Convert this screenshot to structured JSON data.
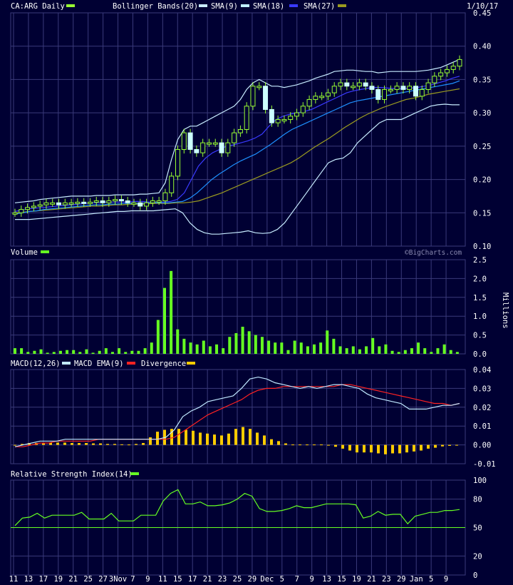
{
  "symbol_label": "CA:ARG Daily",
  "date": "1/10/17",
  "watermark": "©BigCharts.com",
  "colors": {
    "background": "#000033",
    "grid": "#3a3a7a",
    "price": "#99ff33",
    "candle_up": "#000033",
    "candle_hi": "#ccffff",
    "bollinger": "#c8ecff",
    "sma9": "#bfefff",
    "sma18": "#3a3aff",
    "sma27": "#1e90ff",
    "sma_olive": "#9a9a20",
    "volume": "#66ff22",
    "macd": "#c0e8ff",
    "macd_ema": "#ff2222",
    "divergence": "#ffcc00",
    "rsi": "#66ff22",
    "rsi_mid": "#66ff22"
  },
  "legend": {
    "main": [
      {
        "label": "CA:ARG Daily",
        "color": "#99ff33"
      },
      {
        "label": "Bollinger Bands(20)",
        "color": "#c8ecff"
      },
      {
        "label": "SMA(9)",
        "color": "#bfefff"
      },
      {
        "label": "SMA(18)",
        "color": "#3a3aff"
      },
      {
        "label": "SMA(27)",
        "color": "#9a9a20"
      }
    ],
    "volume": "Volume",
    "volume_unit": "Millions",
    "macd": [
      {
        "label": "MACD(12,26)",
        "color": "#c0e8ff"
      },
      {
        "label": "MACD EMA(9)",
        "color": "#ff2222"
      },
      {
        "label": "Divergence",
        "color": "#ffcc00"
      }
    ],
    "rsi": "Relative Strength Index(14)"
  },
  "chart_data": [
    {
      "type": "line",
      "title": "CA:ARG Daily",
      "ylim": [
        0.1,
        0.45
      ],
      "yticks": [
        "0.45",
        "0.40",
        "0.35",
        "0.30",
        "0.25",
        "0.20",
        "0.15",
        "0.10"
      ],
      "xticks": [
        "11",
        "13",
        "17",
        "19",
        "21",
        "25",
        "27",
        "3Nov",
        "7",
        "9",
        "11",
        "15",
        "17",
        "21",
        "23",
        "25",
        "29",
        "Dec",
        "5",
        "7",
        "9",
        "13",
        "15",
        "19",
        "21",
        "23",
        "29",
        "Jan",
        "5",
        "9"
      ],
      "candles_close": [
        0.15,
        0.155,
        0.158,
        0.16,
        0.162,
        0.165,
        0.165,
        0.162,
        0.165,
        0.165,
        0.166,
        0.165,
        0.166,
        0.168,
        0.165,
        0.168,
        0.17,
        0.168,
        0.165,
        0.165,
        0.16,
        0.165,
        0.168,
        0.168,
        0.18,
        0.205,
        0.245,
        0.27,
        0.245,
        0.24,
        0.255,
        0.255,
        0.255,
        0.24,
        0.255,
        0.27,
        0.275,
        0.31,
        0.34,
        0.34,
        0.305,
        0.285,
        0.29,
        0.29,
        0.295,
        0.3,
        0.31,
        0.32,
        0.325,
        0.325,
        0.33,
        0.34,
        0.345,
        0.34,
        0.34,
        0.345,
        0.34,
        0.335,
        0.32,
        0.335,
        0.335,
        0.34,
        0.335,
        0.34,
        0.325,
        0.335,
        0.345,
        0.355,
        0.36,
        0.365,
        0.37,
        0.38
      ],
      "bb_upper": [
        0.165,
        0.166,
        0.167,
        0.168,
        0.17,
        0.171,
        0.172,
        0.173,
        0.174,
        0.175,
        0.175,
        0.175,
        0.175,
        0.176,
        0.176,
        0.176,
        0.177,
        0.177,
        0.177,
        0.177,
        0.178,
        0.178,
        0.179,
        0.18,
        0.195,
        0.23,
        0.26,
        0.275,
        0.28,
        0.28,
        0.285,
        0.29,
        0.295,
        0.3,
        0.305,
        0.31,
        0.32,
        0.335,
        0.345,
        0.35,
        0.345,
        0.34,
        0.34,
        0.338,
        0.34,
        0.342,
        0.345,
        0.348,
        0.352,
        0.355,
        0.358,
        0.362,
        0.363,
        0.364,
        0.364,
        0.363,
        0.362,
        0.362,
        0.36,
        0.361,
        0.362,
        0.362,
        0.362,
        0.362,
        0.362,
        0.363,
        0.364,
        0.366,
        0.368,
        0.372,
        0.376,
        0.38
      ],
      "bb_lower": [
        0.14,
        0.14,
        0.14,
        0.141,
        0.142,
        0.143,
        0.144,
        0.145,
        0.146,
        0.147,
        0.148,
        0.149,
        0.15,
        0.151,
        0.152,
        0.152,
        0.153,
        0.153,
        0.153,
        0.153,
        0.154,
        0.155,
        0.156,
        0.15,
        0.135,
        0.125,
        0.12,
        0.118,
        0.118,
        0.119,
        0.12,
        0.121,
        0.123,
        0.12,
        0.119,
        0.12,
        0.125,
        0.135,
        0.15,
        0.165,
        0.18,
        0.195,
        0.21,
        0.225,
        0.23,
        0.232,
        0.24,
        0.255,
        0.265,
        0.275,
        0.285,
        0.29,
        0.29,
        0.29,
        0.295,
        0.3,
        0.305,
        0.31,
        0.312,
        0.313,
        0.312,
        0.312
      ],
      "sma9": [
        0.152,
        0.154,
        0.156,
        0.157,
        0.158,
        0.159,
        0.16,
        0.161,
        0.162,
        0.163,
        0.164,
        0.165,
        0.165,
        0.166,
        0.166,
        0.166,
        0.166,
        0.167,
        0.167,
        0.166,
        0.166,
        0.166,
        0.167,
        0.17,
        0.18,
        0.2,
        0.22,
        0.232,
        0.24,
        0.245,
        0.25,
        0.252,
        0.255,
        0.258,
        0.262,
        0.268,
        0.28,
        0.29,
        0.295,
        0.298,
        0.3,
        0.302,
        0.305,
        0.31,
        0.315,
        0.32,
        0.325,
        0.33,
        0.333,
        0.335,
        0.337,
        0.338,
        0.338,
        0.337,
        0.336,
        0.336,
        0.337,
        0.338,
        0.34,
        0.342,
        0.345,
        0.348,
        0.352,
        0.355
      ],
      "sma18": [
        0.148,
        0.15,
        0.152,
        0.153,
        0.155,
        0.156,
        0.157,
        0.158,
        0.159,
        0.16,
        0.161,
        0.162,
        0.162,
        0.163,
        0.163,
        0.164,
        0.164,
        0.164,
        0.165,
        0.165,
        0.165,
        0.165,
        0.166,
        0.167,
        0.172,
        0.18,
        0.19,
        0.2,
        0.208,
        0.215,
        0.222,
        0.228,
        0.233,
        0.238,
        0.245,
        0.252,
        0.26,
        0.268,
        0.275,
        0.28,
        0.285,
        0.29,
        0.295,
        0.3,
        0.305,
        0.31,
        0.315,
        0.318,
        0.32,
        0.322,
        0.324,
        0.326,
        0.328,
        0.33,
        0.332,
        0.334,
        0.336,
        0.338,
        0.34,
        0.342,
        0.344,
        0.348
      ],
      "sma27": [
        0.15,
        0.151,
        0.152,
        0.153,
        0.154,
        0.155,
        0.156,
        0.157,
        0.158,
        0.159,
        0.16,
        0.16,
        0.161,
        0.162,
        0.162,
        0.163,
        0.163,
        0.163,
        0.164,
        0.164,
        0.164,
        0.165,
        0.165,
        0.166,
        0.168,
        0.172,
        0.176,
        0.18,
        0.185,
        0.19,
        0.195,
        0.2,
        0.205,
        0.21,
        0.215,
        0.22,
        0.225,
        0.232,
        0.24,
        0.248,
        0.255,
        0.262,
        0.27,
        0.278,
        0.285,
        0.292,
        0.298,
        0.303,
        0.308,
        0.312,
        0.316,
        0.32,
        0.322,
        0.325,
        0.328,
        0.33,
        0.332,
        0.334,
        0.336
      ]
    },
    {
      "type": "bar",
      "title": "Volume",
      "ylabel": "Millions",
      "ylim": [
        0,
        2.5
      ],
      "yticks": [
        "2.5",
        "2.0",
        "1.5",
        "1.0",
        "0.5",
        "0.0"
      ],
      "values": [
        0.15,
        0.15,
        0.05,
        0.08,
        0.12,
        0.03,
        0.05,
        0.08,
        0.1,
        0.1,
        0.05,
        0.12,
        0.03,
        0.08,
        0.15,
        0.05,
        0.15,
        0.05,
        0.08,
        0.08,
        0.15,
        0.3,
        0.9,
        1.75,
        2.2,
        0.65,
        0.4,
        0.3,
        0.25,
        0.35,
        0.2,
        0.25,
        0.15,
        0.45,
        0.55,
        0.72,
        0.6,
        0.5,
        0.45,
        0.35,
        0.3,
        0.3,
        0.1,
        0.35,
        0.3,
        0.2,
        0.25,
        0.3,
        0.62,
        0.4,
        0.2,
        0.15,
        0.2,
        0.12,
        0.2,
        0.42,
        0.2,
        0.25,
        0.08,
        0.05,
        0.1,
        0.15,
        0.3,
        0.15,
        0.05,
        0.15,
        0.25,
        0.1,
        0.05
      ],
      "series": [
        {
          "name": "Volume",
          "values": []
        }
      ]
    },
    {
      "type": "line",
      "title": "MACD",
      "ylim": [
        -0.01,
        0.04
      ],
      "yticks": [
        "0.04",
        "0.03",
        "0.02",
        "0.01",
        "0.00",
        "-0.01"
      ],
      "series": [
        {
          "name": "MACD(12,26)",
          "values": [
            -0.001,
            0.0,
            0.001,
            0.002,
            0.002,
            0.002,
            0.003,
            0.003,
            0.003,
            0.003,
            0.003,
            0.003,
            0.003,
            0.003,
            0.003,
            0.003,
            0.003,
            0.003,
            0.004,
            0.008,
            0.015,
            0.018,
            0.02,
            0.023,
            0.024,
            0.025,
            0.026,
            0.03,
            0.035,
            0.036,
            0.035,
            0.033,
            0.032,
            0.031,
            0.03,
            0.031,
            0.03,
            0.031,
            0.032,
            0.032,
            0.031,
            0.03,
            0.027,
            0.025,
            0.024,
            0.023,
            0.022,
            0.019,
            0.019,
            0.019,
            0.02,
            0.021,
            0.021,
            0.022
          ]
        },
        {
          "name": "MACD EMA(9)",
          "values": [
            -0.001,
            -0.001,
            0.0,
            0.001,
            0.001,
            0.002,
            0.002,
            0.002,
            0.002,
            0.002,
            0.003,
            0.003,
            0.003,
            0.003,
            0.003,
            0.003,
            0.003,
            0.003,
            0.003,
            0.004,
            0.007,
            0.01,
            0.013,
            0.016,
            0.018,
            0.02,
            0.022,
            0.024,
            0.027,
            0.029,
            0.03,
            0.03,
            0.031,
            0.031,
            0.031,
            0.031,
            0.031,
            0.031,
            0.031,
            0.032,
            0.032,
            0.031,
            0.03,
            0.029,
            0.028,
            0.027,
            0.026,
            0.025,
            0.024,
            0.023,
            0.022,
            0.022,
            0.021,
            0.022
          ]
        },
        {
          "name": "Divergence",
          "values": [
            0.0,
            0.0005,
            0.001,
            0.001,
            0.001,
            0.0012,
            0.0012,
            0.0012,
            0.001,
            0.001,
            0.001,
            0.0008,
            0.0008,
            0.0005,
            0.0005,
            0.0003,
            0.0002,
            0.0005,
            0.001,
            0.004,
            0.007,
            0.008,
            0.0085,
            0.0085,
            0.008,
            0.0075,
            0.0065,
            0.006,
            0.0055,
            0.005,
            0.006,
            0.0085,
            0.0095,
            0.0085,
            0.0065,
            0.005,
            0.003,
            0.002,
            0.0008,
            0.0002,
            0.0002,
            0.0002,
            0.0002,
            0.0002,
            -0.0002,
            -0.001,
            -0.002,
            -0.003,
            -0.004,
            -0.004,
            -0.004,
            -0.0045,
            -0.005,
            -0.0045,
            -0.0045,
            -0.004,
            -0.0035,
            -0.003,
            -0.002,
            -0.0015,
            -0.0008,
            -0.0005,
            -0.0002
          ]
        }
      ]
    },
    {
      "type": "line",
      "title": "Relative Strength Index(14)",
      "ylim": [
        0,
        100
      ],
      "yticks": [
        "100",
        "80",
        "50",
        "20",
        "0"
      ],
      "values": [
        52,
        60,
        61,
        65,
        60,
        63,
        63,
        63,
        63,
        66,
        59,
        59,
        59,
        65,
        57,
        57,
        57,
        63,
        63,
        63,
        78,
        86,
        90,
        75,
        75,
        77,
        73,
        73,
        74,
        76,
        80,
        86,
        83,
        70,
        67,
        67,
        68,
        70,
        73,
        71,
        71,
        73,
        75,
        75,
        75,
        75,
        74,
        60,
        62,
        67,
        63,
        64,
        64,
        54,
        62,
        64,
        66,
        66,
        68,
        68,
        69
      ]
    }
  ]
}
